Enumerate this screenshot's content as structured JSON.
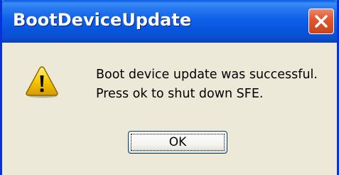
{
  "dialog": {
    "title": "BootDeviceUpdate",
    "close_icon": "close-icon",
    "message_icon": "warning-icon",
    "message_lines": [
      "Boot device update was successful.",
      "Press ok to shut down SFE."
    ],
    "ok_label": "OK"
  },
  "colors": {
    "titlebar": "#0a5ae0",
    "close_button": "#e0582f",
    "dialog_background": "#ece9d8",
    "warning_fill": "#f5c800"
  }
}
